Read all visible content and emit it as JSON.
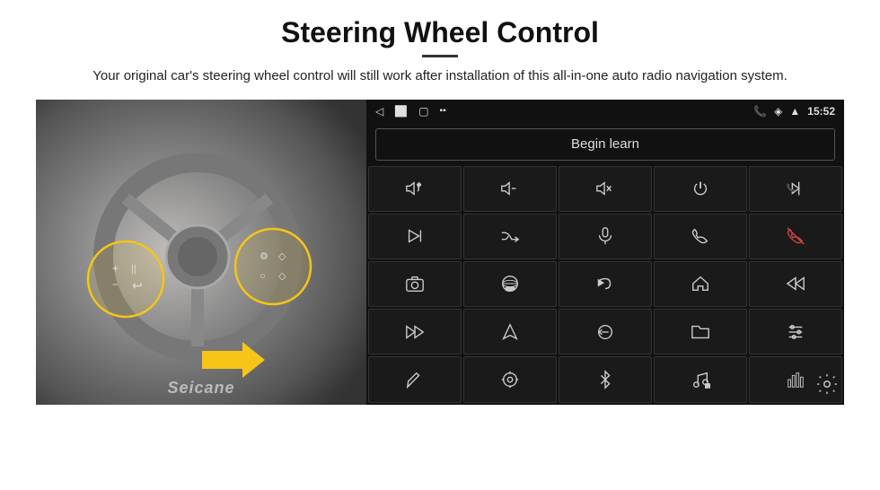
{
  "header": {
    "title": "Steering Wheel Control",
    "divider": true,
    "subtitle": "Your original car's steering wheel control will still work after installation of this all-in-one auto radio navigation system."
  },
  "panel": {
    "begin_learn_label": "Begin learn",
    "status_time": "15:52"
  },
  "controls": [
    {
      "id": "vol-up",
      "icon": "vol-up",
      "unicode": "🔊+"
    },
    {
      "id": "vol-down",
      "icon": "vol-down",
      "unicode": "🔉−"
    },
    {
      "id": "vol-mute",
      "icon": "vol-mute",
      "unicode": "🔇"
    },
    {
      "id": "power",
      "icon": "power",
      "unicode": "⏻"
    },
    {
      "id": "prev-track",
      "icon": "prev-track",
      "unicode": "⏮"
    },
    {
      "id": "skip-next",
      "icon": "skip-next",
      "unicode": "⏭"
    },
    {
      "id": "skip-prev2",
      "icon": "skip-prev2",
      "unicode": "⏮⏭"
    },
    {
      "id": "mic",
      "icon": "mic",
      "unicode": "🎤"
    },
    {
      "id": "phone",
      "icon": "phone",
      "unicode": "📞"
    },
    {
      "id": "hang-up",
      "icon": "hang-up",
      "unicode": "📵"
    },
    {
      "id": "cam",
      "icon": "cam",
      "unicode": "📷"
    },
    {
      "id": "view360",
      "icon": "view360",
      "unicode": "360"
    },
    {
      "id": "back",
      "icon": "back",
      "unicode": "↩"
    },
    {
      "id": "home",
      "icon": "home",
      "unicode": "🏠"
    },
    {
      "id": "skip-back",
      "icon": "skip-back",
      "unicode": "⏮"
    },
    {
      "id": "ff",
      "icon": "ff",
      "unicode": "⏭"
    },
    {
      "id": "nav",
      "icon": "nav",
      "unicode": "▶"
    },
    {
      "id": "transfer",
      "icon": "transfer",
      "unicode": "⇄"
    },
    {
      "id": "folder",
      "icon": "folder",
      "unicode": "📁"
    },
    {
      "id": "sliders",
      "icon": "sliders",
      "unicode": "🎚"
    },
    {
      "id": "pen",
      "icon": "pen",
      "unicode": "✏"
    },
    {
      "id": "target",
      "icon": "target",
      "unicode": "🎯"
    },
    {
      "id": "bluetooth",
      "icon": "bluetooth",
      "unicode": "⚡"
    },
    {
      "id": "music",
      "icon": "music",
      "unicode": "🎵"
    },
    {
      "id": "equalizer",
      "icon": "equalizer",
      "unicode": "📊"
    }
  ],
  "watermark": "Seicane"
}
